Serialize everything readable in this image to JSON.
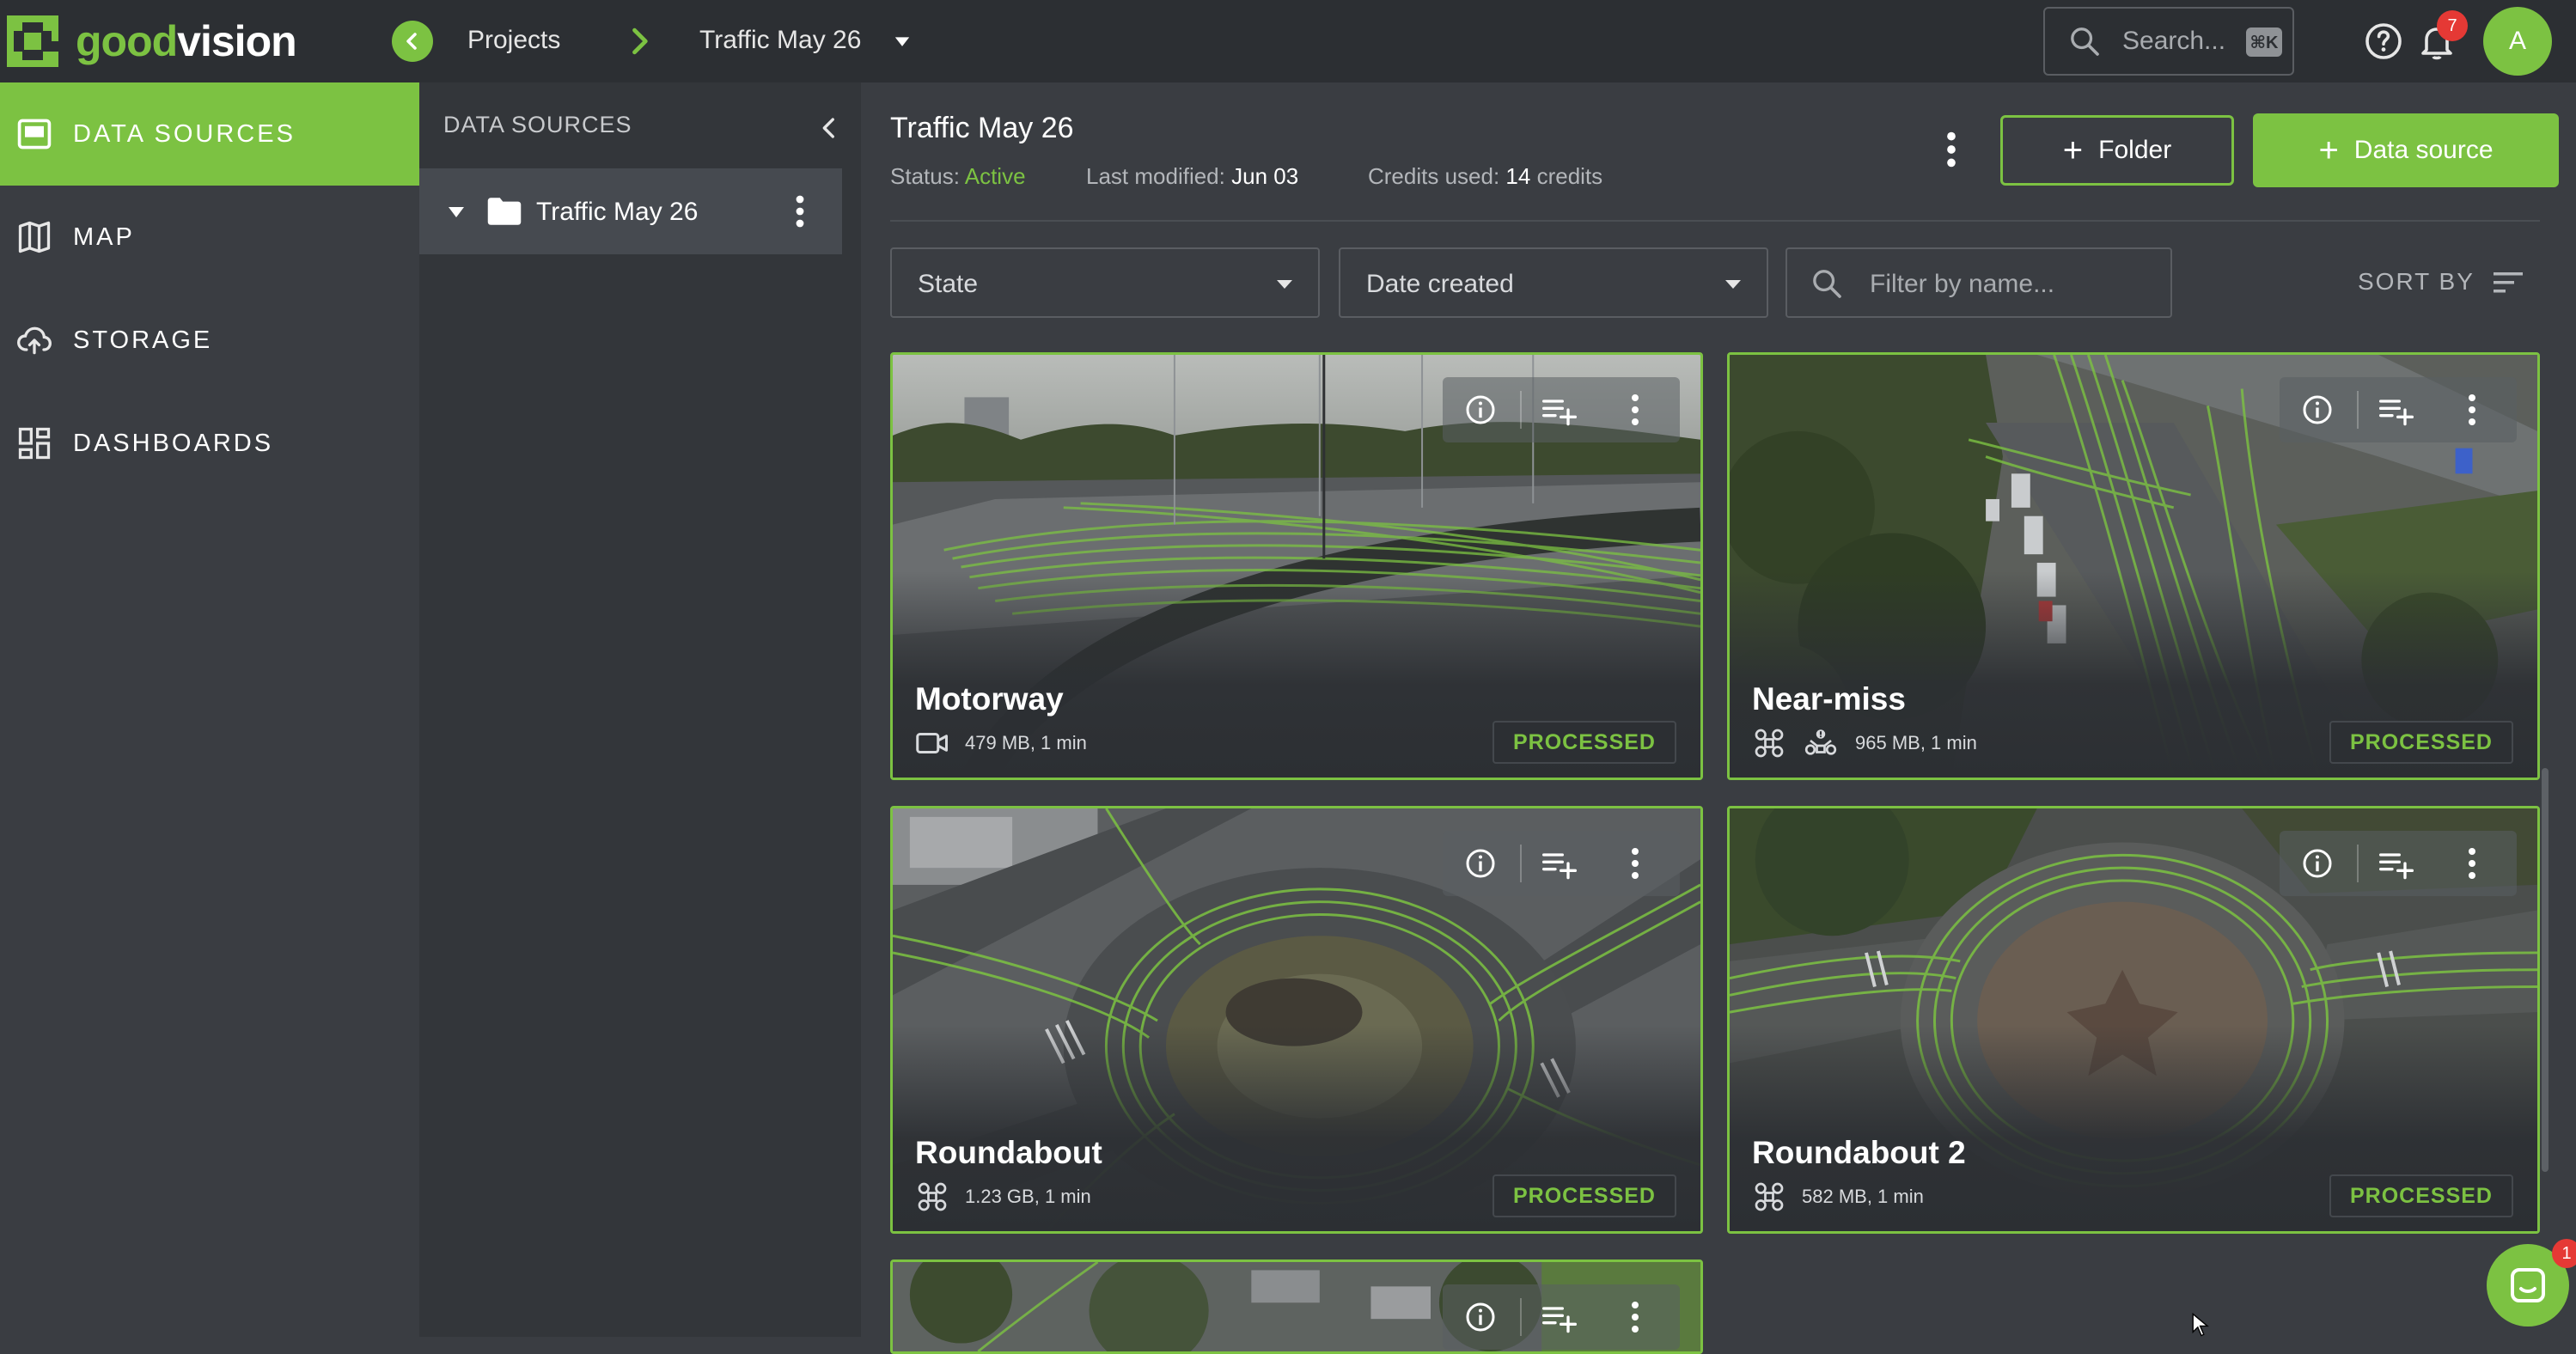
{
  "app": {
    "logo_part1": "good",
    "logo_part2": "vision"
  },
  "header": {
    "breadcrumb_projects": "Projects",
    "breadcrumb_current": "Traffic May 26",
    "search_placeholder": "Search...",
    "search_shortcut": "⌘K",
    "notification_count": "7",
    "avatar_initial": "A"
  },
  "sidebar": {
    "items": [
      {
        "label": "DATA SOURCES",
        "icon": "data-sources-icon",
        "active": true
      },
      {
        "label": "MAP",
        "icon": "map-icon",
        "active": false
      },
      {
        "label": "STORAGE",
        "icon": "cloud-upload-icon",
        "active": false
      },
      {
        "label": "DASHBOARDS",
        "icon": "dashboard-icon",
        "active": false
      }
    ]
  },
  "tree": {
    "header": "DATA SOURCES",
    "folder_name": "Traffic May 26"
  },
  "main": {
    "title": "Traffic May 26",
    "status_label": "Status:",
    "status_value": "Active",
    "modified_label": "Last modified:",
    "modified_value": "Jun 03",
    "credits_label": "Credits used:",
    "credits_value": "14",
    "credits_unit": "credits",
    "folder_button": "Folder",
    "datasource_button": "Data source",
    "state_select": "State",
    "date_select": "Date created",
    "filter_placeholder": "Filter by name...",
    "sort_by": "SORT BY"
  },
  "cards": [
    {
      "title": "Motorway",
      "info": "479 MB, 1 min",
      "status": "PROCESSED",
      "icons": [
        "video-icon"
      ]
    },
    {
      "title": "Near-miss",
      "info": "965 MB, 1 min",
      "status": "PROCESSED",
      "icons": [
        "drone-icon",
        "near-miss-drone-icon"
      ]
    },
    {
      "title": "Roundabout",
      "info": "1.23 GB, 1 min",
      "status": "PROCESSED",
      "icons": [
        "drone-icon"
      ]
    },
    {
      "title": "Roundabout 2",
      "info": "582 MB, 1 min",
      "status": "PROCESSED",
      "icons": [
        "drone-icon"
      ]
    }
  ],
  "chat": {
    "badge": "1"
  },
  "colors": {
    "accent": "#7cc242",
    "topbar": "#2c2f33",
    "sidebar": "#3a3d42",
    "tree": "#33363a",
    "danger": "#e53935"
  }
}
